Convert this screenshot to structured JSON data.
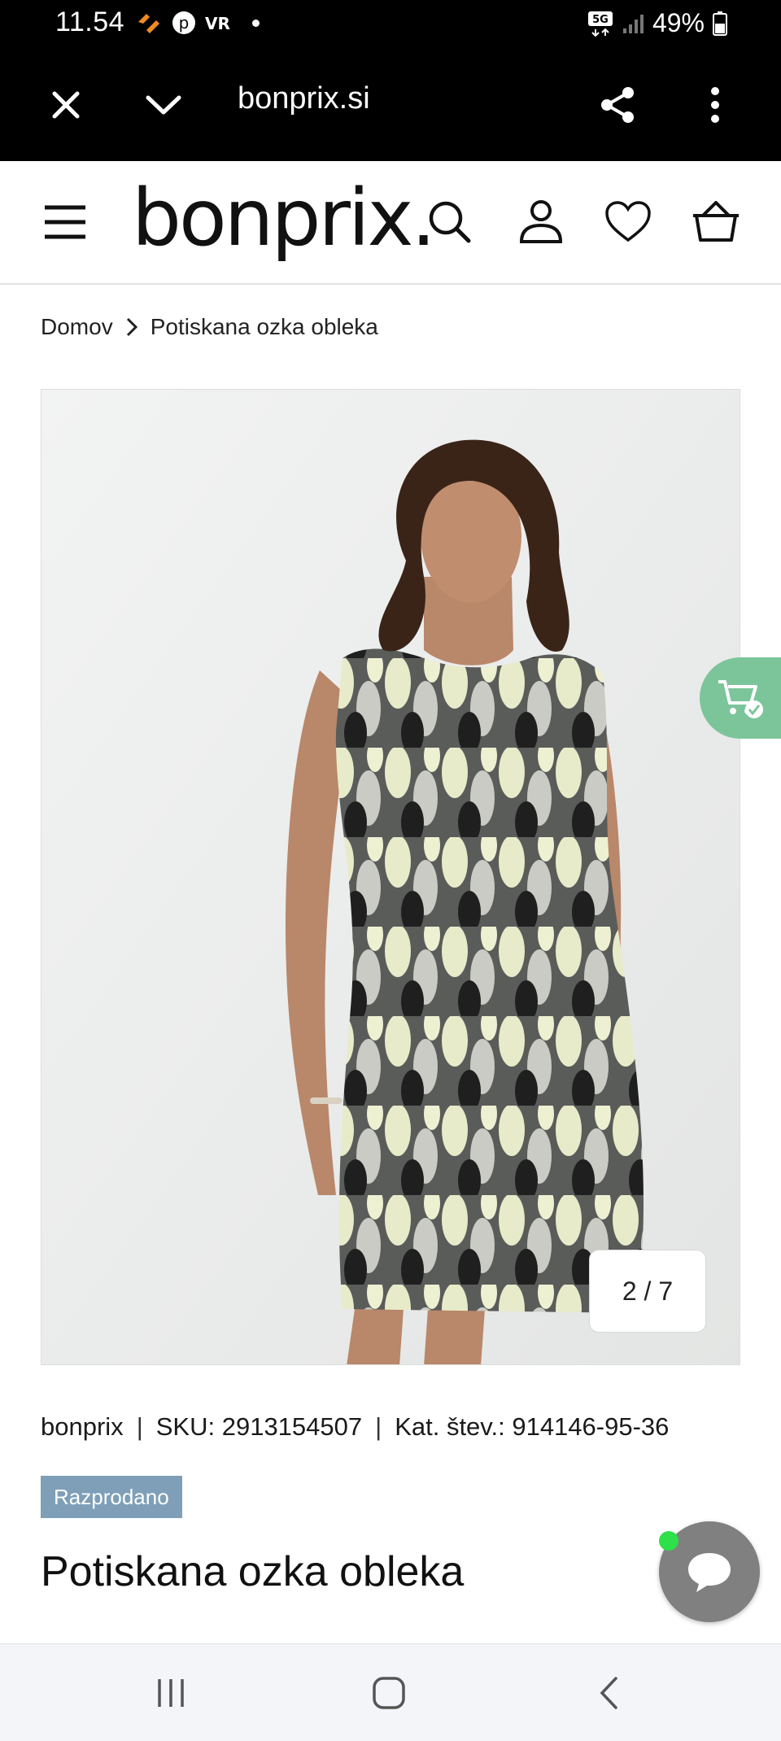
{
  "status_bar": {
    "time": "11.54",
    "network": "5G",
    "battery": "49%"
  },
  "browser": {
    "url": "bonprix.si"
  },
  "header": {
    "logo_text": "bonprix."
  },
  "breadcrumb": {
    "items": [
      "Domov",
      "Potiskana ozka obleka"
    ]
  },
  "gallery": {
    "counter": "2 / 7"
  },
  "product": {
    "brand": "bonprix",
    "sku": "SKU: 2913154507",
    "catalog_number": "Kat. štev.: 914146-95-36",
    "badge": "Razprodano",
    "title": "Potiskana ozka obleka"
  },
  "colors": {
    "badge_bg": "#7e9fb7",
    "cart_tab": "#7cc59a",
    "chat_button": "#808080",
    "online_dot": "#2ee04a"
  },
  "icons": {
    "close": "close-icon",
    "tabs": "chevron-down-icon",
    "share": "share-icon",
    "more": "more-vertical-icon",
    "menu": "hamburger-menu-icon",
    "search": "search-icon",
    "account": "user-icon",
    "wishlist": "heart-icon",
    "basket": "basket-icon",
    "cart_check": "cart-check-icon",
    "chat": "chat-bubble-icon"
  }
}
